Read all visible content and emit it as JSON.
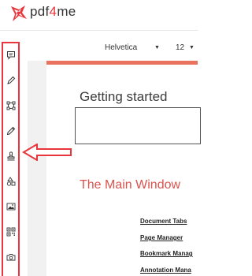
{
  "app": {
    "logo_prefix": "pdf",
    "logo_accent": "4",
    "logo_suffix": "me",
    "brand_color": "#e9353c"
  },
  "toolbar": {
    "font_family": "Helvetica",
    "font_size": "12"
  },
  "sidebar": {
    "items": [
      {
        "name": "comment-icon"
      },
      {
        "name": "pen-icon"
      },
      {
        "name": "selection-icon"
      },
      {
        "name": "pencil-icon"
      },
      {
        "name": "stamp-icon"
      },
      {
        "name": "shapes-icon"
      },
      {
        "name": "image-icon"
      },
      {
        "name": "qr-code-icon"
      },
      {
        "name": "camera-icon"
      }
    ]
  },
  "document": {
    "title": "Getting started",
    "heading": "The Main Window",
    "toc": [
      "Document Tabs",
      "Page Manager",
      "Bookmark Manag",
      "Annotation Mana"
    ]
  },
  "colors": {
    "accent": "#e9353c",
    "page_top_bar": "#e9735f",
    "heading": "#d9534f"
  }
}
